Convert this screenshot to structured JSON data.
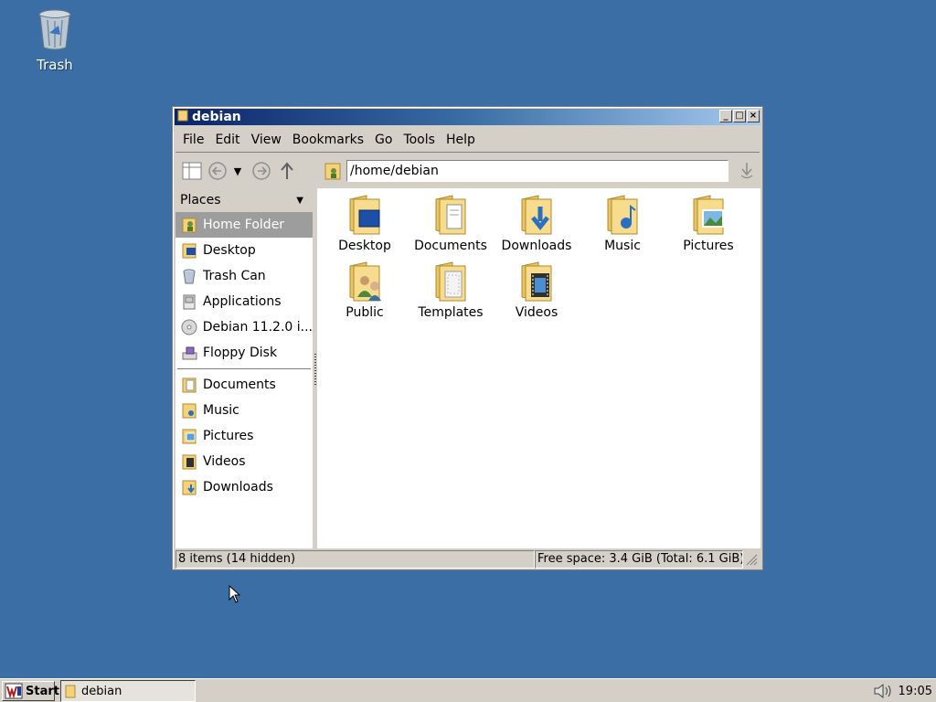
{
  "desktop": {
    "trash_label": "Trash"
  },
  "window": {
    "title": "debian",
    "menu": [
      "File",
      "Edit",
      "View",
      "Bookmarks",
      "Go",
      "Tools",
      "Help"
    ],
    "location": "/home/debian",
    "places_header": "Places",
    "places": [
      {
        "label": "Home Folder",
        "icon": "home-folder-icon"
      },
      {
        "label": "Desktop",
        "icon": "desktop-icon"
      },
      {
        "label": "Trash Can",
        "icon": "trash-icon"
      },
      {
        "label": "Applications",
        "icon": "applications-icon"
      },
      {
        "label": "Debian 11.2.0 i...",
        "icon": "cdrom-icon"
      },
      {
        "label": "Floppy Disk",
        "icon": "floppy-icon"
      }
    ],
    "bookmarks": [
      {
        "label": "Documents",
        "icon": "documents-folder-icon"
      },
      {
        "label": "Music",
        "icon": "music-folder-icon"
      },
      {
        "label": "Pictures",
        "icon": "pictures-folder-icon"
      },
      {
        "label": "Videos",
        "icon": "videos-folder-icon"
      },
      {
        "label": "Downloads",
        "icon": "downloads-folder-icon"
      }
    ],
    "files": [
      {
        "label": "Desktop",
        "icon": "desktop-folder-icon"
      },
      {
        "label": "Documents",
        "icon": "documents-folder-icon"
      },
      {
        "label": "Downloads",
        "icon": "downloads-folder-icon"
      },
      {
        "label": "Music",
        "icon": "music-folder-icon"
      },
      {
        "label": "Pictures",
        "icon": "pictures-folder-icon"
      },
      {
        "label": "Public",
        "icon": "public-folder-icon"
      },
      {
        "label": "Templates",
        "icon": "templates-folder-icon"
      },
      {
        "label": "Videos",
        "icon": "videos-folder-icon"
      }
    ],
    "status_items": "8 items (14 hidden)",
    "status_space": "Free space: 3.4 GiB (Total: 6.1 GiB)"
  },
  "taskbar": {
    "start_label": "Start",
    "task_label": "debian",
    "clock": "19:05"
  },
  "colors": {
    "desktop": "#3a6ea5",
    "selection": "#9d9d9d",
    "folder": "#f3d27a"
  }
}
